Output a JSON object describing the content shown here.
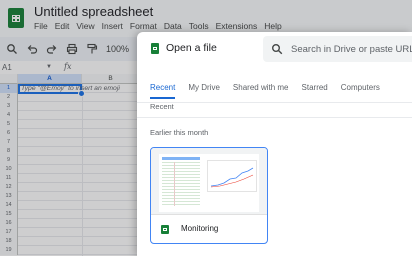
{
  "spreadsheet": {
    "title": "Untitled spreadsheet",
    "menu": [
      "File",
      "Edit",
      "View",
      "Insert",
      "Format",
      "Data",
      "Tools",
      "Extensions",
      "Help"
    ],
    "zoom": "100%",
    "name_box": "A1",
    "fx_symbol": "fx",
    "columns": [
      "A",
      "B"
    ],
    "rows": [
      "1",
      "2",
      "3",
      "4",
      "5",
      "6",
      "7",
      "8",
      "9",
      "10",
      "11",
      "12",
      "13",
      "14",
      "15",
      "16",
      "17",
      "18",
      "19"
    ],
    "cell_hint": "Type \"@Emoji\" to insert an emoji",
    "accent": "#1a73e8",
    "brand_green": "#188038"
  },
  "dialog": {
    "title": "Open a file",
    "search_placeholder": "Search in Drive or paste URL",
    "tabs": [
      "Recent",
      "My Drive",
      "Shared with me",
      "Starred",
      "Computers"
    ],
    "active_tab": "Recent",
    "sub_header": "Recent",
    "section_label": "Earlier this month",
    "files": [
      {
        "name": "Monitoring",
        "icon": "sheets-file-icon"
      }
    ],
    "accent": "#1967d2"
  }
}
